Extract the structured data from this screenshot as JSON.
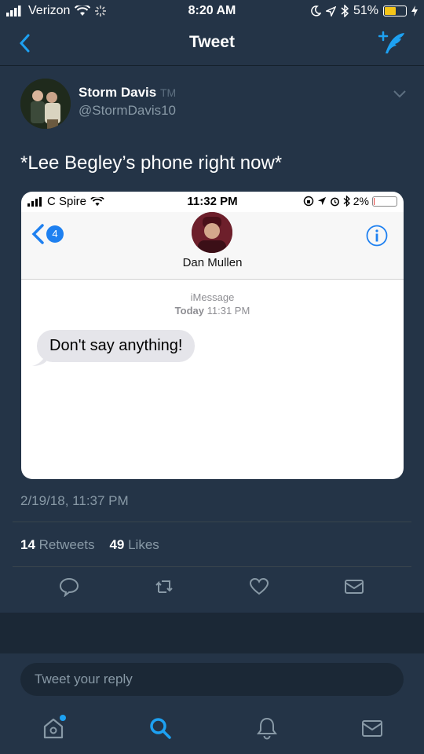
{
  "status_bar": {
    "carrier": "Verizon",
    "time": "8:20 AM",
    "battery": "51%",
    "battery_level": 0.51
  },
  "nav": {
    "title": "Tweet",
    "back_icon": "chevron-left-icon",
    "compose_icon": "compose-tweet-icon"
  },
  "tweet": {
    "author_name": "Storm Davis",
    "author_suffix": "TM",
    "handle": "@StormDavis10",
    "text": "*Lee Begley’s phone right now*",
    "timestamp": "2/19/18, 11:37 PM",
    "retweets": "14",
    "retweets_label": "Retweets",
    "likes": "49",
    "likes_label": "Likes"
  },
  "embedded_screenshot": {
    "carrier": "C Spire",
    "time": "11:32 PM",
    "battery": "2%",
    "battery_level": 0.02,
    "back_badge": "4",
    "contact_name": "Dan Mullen",
    "service": "iMessage",
    "date_label": "Today",
    "date_time": "11:31 PM",
    "message": "Don't say anything!"
  },
  "reply": {
    "placeholder": "Tweet your reply"
  },
  "colors": {
    "background": "#243447",
    "accent": "#1da1f2",
    "muted": "#8899a6"
  }
}
